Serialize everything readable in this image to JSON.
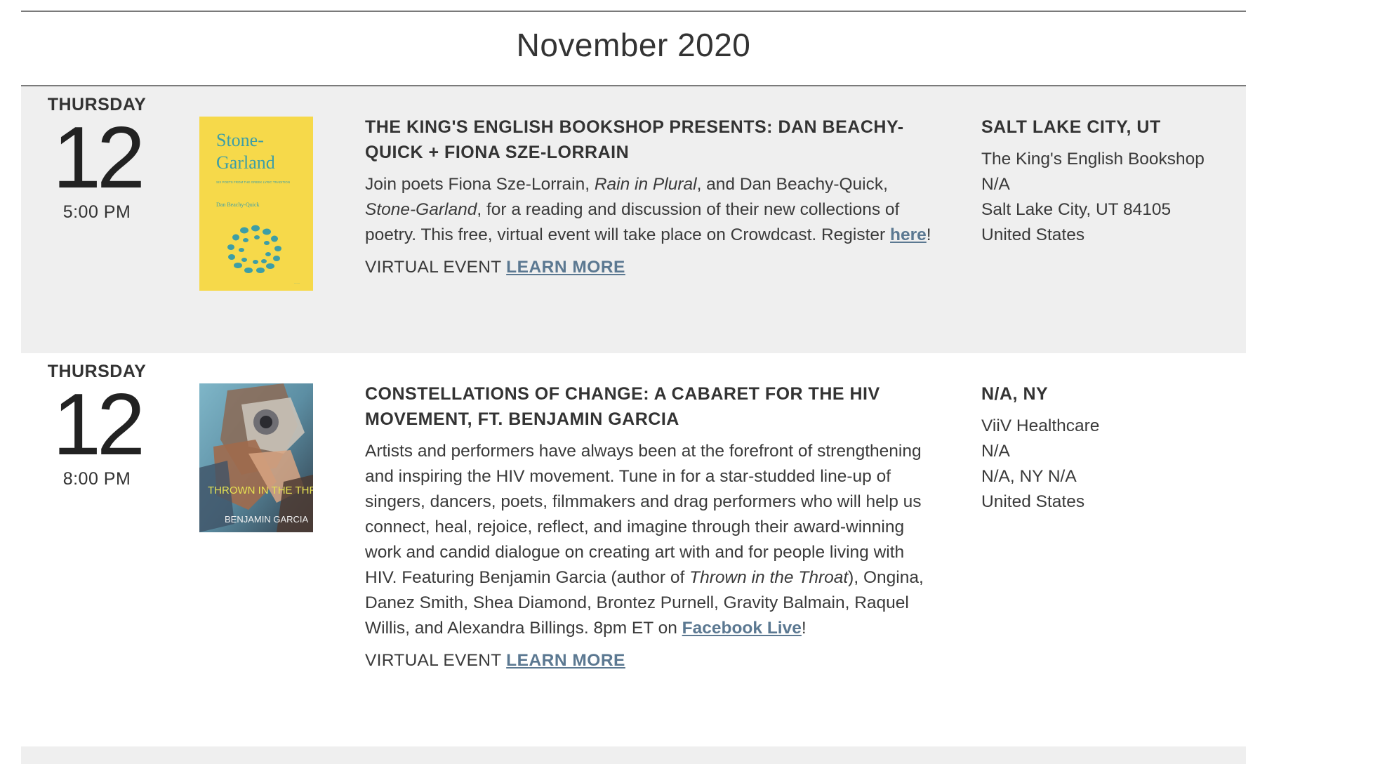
{
  "month_heading": "November 2020",
  "events": [
    {
      "weekday": "THURSDAY",
      "day": "12",
      "time": "5:00 PM",
      "cover_title": "Stone-\nGarland",
      "cover_subtitle": "SIX POETS FROM THE GREEK LYRIC TRADITION",
      "cover_author": "Dan Beachy-Quick",
      "title": "THE KING'S ENGLISH BOOKSHOP PRESENTS: DAN BEACHY-QUICK + FIONA SZE-LORRAIN",
      "desc": {
        "p1": "Join poets Fiona Sze-Lorrain, ",
        "book1": "Rain in Plural",
        "p2": ", and Dan Beachy-Quick, ",
        "book2": "Stone-Garland",
        "p3": ", for a reading and discussion of their new collections of poetry. This free, virtual event will take place on Crowdcast. Register ",
        "link": "here",
        "p4": "!"
      },
      "event_type": "VIRTUAL EVENT",
      "learn_more": "LEARN MORE",
      "location": {
        "title": "SALT LAKE CITY, UT",
        "venue": "The King's English Bookshop",
        "address": "N/A",
        "city_zip": "Salt Lake City, UT 84105",
        "country": "United States"
      }
    },
    {
      "weekday": "THURSDAY",
      "day": "12",
      "time": "8:00 PM",
      "cover_title": "THROWN IN THE THROAT",
      "cover_author": "BENJAMIN GARCIA",
      "title": "CONSTELLATIONS OF CHANGE: A CABARET FOR THE HIV MOVEMENT, FT. BENJAMIN GARCIA",
      "desc": {
        "p1": "Artists and performers have always been at the forefront of strengthening and inspiring the HIV movement. Tune in for a star-studded line-up of singers, dancers, poets, filmmakers and drag performers who will help us connect, heal, rejoice, reflect, and imagine through their award-winning work and candid dialogue on creating art with and for people living with HIV. Featuring Benjamin Garcia (author of ",
        "book1": "Thrown in the Throat",
        "p2": "), Ongina, Danez Smith, Shea Diamond, Brontez Purnell, Gravity Balmain, Raquel Willis, and Alexandra Billings. 8pm ET on ",
        "link": "Facebook Live",
        "p3": "!"
      },
      "event_type": "VIRTUAL EVENT",
      "learn_more": "LEARN MORE",
      "location": {
        "title": "N/A, NY",
        "venue": "ViiV Healthcare",
        "address": "N/A",
        "city_zip": "N/A, NY N/A",
        "country": "United States"
      }
    }
  ],
  "colors": {
    "link": "#5b7891",
    "shaded_row": "#efefef",
    "rule": "#7a7a7a",
    "cover1_bg": "#f6d94a",
    "cover1_accent": "#3d9ea6"
  }
}
